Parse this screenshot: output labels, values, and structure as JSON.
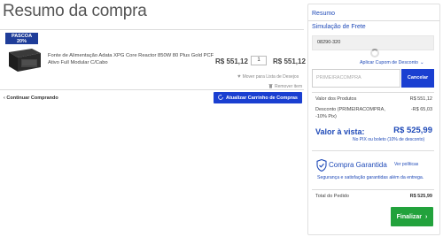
{
  "page_title": "Resumo da compra",
  "cart": {
    "promo_badge_line1": "PASCOA",
    "promo_badge_line2": "20%",
    "product_name": "Fonte de Alimentação Adata XPG Core Reactor 850W 80 Plus Gold PCF Ativo Full Modular C/Cabo",
    "unit_price": "R$ 551,12",
    "quantity": "1",
    "line_total": "R$ 551,12",
    "move_wishlist": "Mover para Lista de Desejos",
    "remove_item": "Remover item",
    "continue_shopping": "Continuar Comprando",
    "update_cart": "Atualizar Carrinho de Compras"
  },
  "summary": {
    "heading": "Resumo",
    "shipping_heading": "Simulação de Frete",
    "cep_value": "08290-320",
    "coupon_toggle": "Aplicar Cupom de Desconto",
    "coupon_placeholder": "PRIMEIRACOMPRA",
    "cancel_label": "Cancelar",
    "products_label": "Valor dos Produtos",
    "products_value": "R$ 551,12",
    "discount_label": "Desconto (PRIMEIRACOMPRA, -10% Pix)",
    "discount_value": "-R$ 65,03",
    "avista_label": "Valor à vista:",
    "avista_value": "R$ 525,99",
    "pix_note": "No PIX ou boleto (10% de desconto)",
    "guarantee_title": "Compra Garantida",
    "policies_link": "Ver políticas",
    "guarantee_text": "Segurança e satisfação garantidas além da entrega.",
    "total_label": "Total do Pedido",
    "total_value": "R$ 525,99",
    "finalize_label": "Finalizar"
  },
  "colors": {
    "brand_blue": "#1a3fd1",
    "link_blue": "#1f4ab8",
    "finalize_green": "#22a23c",
    "badge_navy": "#1f3d99"
  }
}
